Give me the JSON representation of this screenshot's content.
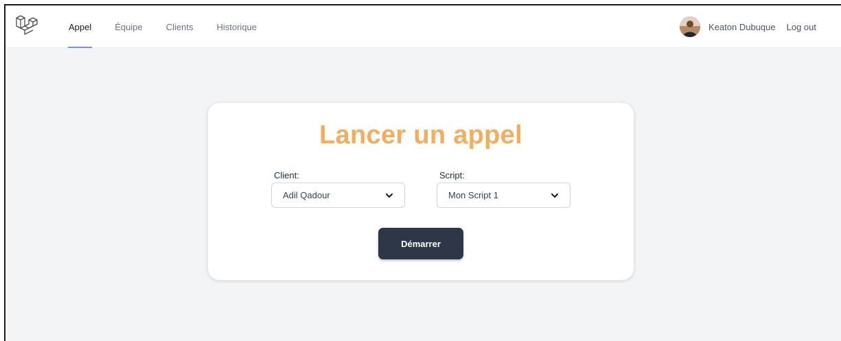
{
  "nav": {
    "links": [
      "Appel",
      "Équipe",
      "Clients",
      "Historique"
    ],
    "active": "Appel"
  },
  "user": {
    "name": "Keaton Dubuque",
    "logout_label": "Log out"
  },
  "card": {
    "title": "Lancer un appel",
    "client_label": "Client:",
    "client_value": "Adil Qadour",
    "script_label": "Script:",
    "script_value": "Mon Script 1",
    "start_label": "Démarrer"
  },
  "colors": {
    "title": "#f3ad5c",
    "button": "#2d3748",
    "active_tab_underline": "#818cf8",
    "background": "#f3f4f6"
  },
  "icons": [
    "laravel-logo",
    "chevron-down-icon",
    "avatar"
  ]
}
